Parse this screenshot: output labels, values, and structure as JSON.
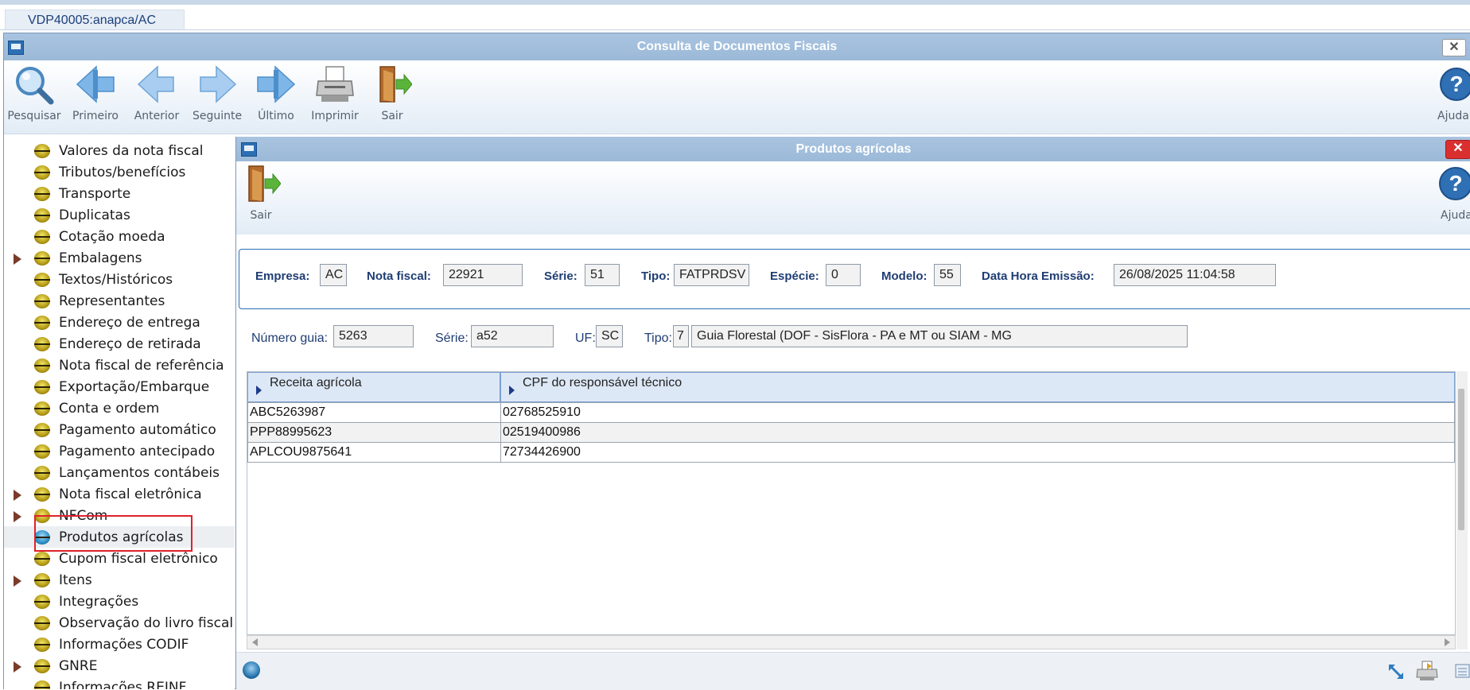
{
  "window_tab": "VDP40005:anapca/AC",
  "main_window": {
    "title": "Consulta de Documentos Fiscais",
    "close_label": "✕",
    "toolbar": [
      {
        "label": "Pesquisar",
        "icon": "magnifier-icon"
      },
      {
        "label": "Primeiro",
        "icon": "first-arrow-icon"
      },
      {
        "label": "Anterior",
        "icon": "previous-arrow-icon"
      },
      {
        "label": "Seguinte",
        "icon": "next-arrow-icon"
      },
      {
        "label": "Último",
        "icon": "last-arrow-icon"
      },
      {
        "label": "Imprimir",
        "icon": "printer-icon"
      },
      {
        "label": "Sair",
        "icon": "exit-door-icon"
      }
    ],
    "help_label": "Ajuda"
  },
  "tree": {
    "items": [
      {
        "label": "Valores da nota fiscal",
        "expandable": false
      },
      {
        "label": "Tributos/benefícios",
        "expandable": false
      },
      {
        "label": "Transporte",
        "expandable": false
      },
      {
        "label": "Duplicatas",
        "expandable": false
      },
      {
        "label": "Cotação moeda",
        "expandable": false
      },
      {
        "label": "Embalagens",
        "expandable": true
      },
      {
        "label": "Textos/Históricos",
        "expandable": false
      },
      {
        "label": "Representantes",
        "expandable": false
      },
      {
        "label": "Endereço de entrega",
        "expandable": false
      },
      {
        "label": "Endereço de retirada",
        "expandable": false
      },
      {
        "label": "Nota fiscal de referência",
        "expandable": false
      },
      {
        "label": "Exportação/Embarque",
        "expandable": false
      },
      {
        "label": "Conta e ordem",
        "expandable": false
      },
      {
        "label": "Pagamento automático",
        "expandable": false
      },
      {
        "label": "Pagamento antecipado",
        "expandable": false
      },
      {
        "label": "Lançamentos contábeis",
        "expandable": false
      },
      {
        "label": "Nota fiscal eletrônica",
        "expandable": true
      },
      {
        "label": "NFCom",
        "expandable": true
      },
      {
        "label": "Produtos agrícolas",
        "expandable": false,
        "selected": true
      },
      {
        "label": "Cupom fiscal eletrônico",
        "expandable": false
      },
      {
        "label": "Itens",
        "expandable": true
      },
      {
        "label": "Integrações",
        "expandable": false
      },
      {
        "label": "Observação do livro fiscal",
        "expandable": false
      },
      {
        "label": "Informações CODIF",
        "expandable": false
      },
      {
        "label": "GNRE",
        "expandable": true
      },
      {
        "label": "Informações REINF",
        "expandable": false
      }
    ]
  },
  "inner_window": {
    "title": "Produtos agrícolas",
    "close_label": "✕",
    "exit_label": "Sair",
    "help_label": "Ajuda",
    "header": {
      "empresa_label": "Empresa:",
      "empresa": "AC",
      "nota_label": "Nota fiscal:",
      "nota": "22921",
      "serie_label": "Série:",
      "serie": "51",
      "tipo_label": "Tipo:",
      "tipo": "FATPRDSV",
      "especie_label": "Espécie:",
      "especie": "0",
      "modelo_label": "Modelo:",
      "modelo": "55",
      "data_label": "Data Hora Emissão:",
      "data": "26/08/2025 11:04:58"
    },
    "guia": {
      "numero_label": "Número guia:",
      "numero": "5263",
      "serie_label": "Série:",
      "serie": "a52",
      "uf_label": "UF:",
      "uf": "SC",
      "tipo_label": "Tipo:",
      "tipo_code": "7",
      "tipo_desc": "Guia Florestal (DOF - SisFlora - PA e MT ou SIAM - MG"
    },
    "grid": {
      "columns": [
        "Receita agrícola",
        "CPF do responsável técnico"
      ],
      "rows": [
        [
          "ABC5263987",
          "02768525910"
        ],
        [
          "PPP88995623",
          "02519400986"
        ],
        [
          "APLCOU9875641",
          "72734426900"
        ]
      ]
    }
  }
}
